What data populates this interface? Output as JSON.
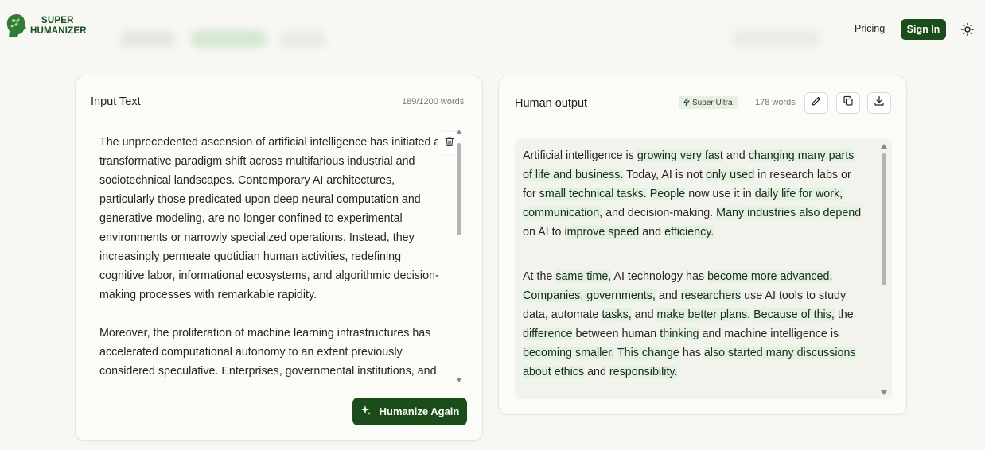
{
  "header": {
    "logo_line1": "SUPER",
    "logo_line2": "HUMANIZER",
    "pricing": "Pricing",
    "sign_in": "Sign In"
  },
  "input": {
    "title": "Input Text",
    "word_count": "189/1200 words",
    "paragraphs": [
      "The unprecedented ascension of artificial intelligence has initiated a transformative paradigm shift across multifarious industrial and sociotechnical landscapes. Contemporary AI architectures, particularly those predicated upon deep neural computation and generative modeling, are no longer confined to experimental environments or narrowly specialized operations. Instead, they increasingly permeate quotidian human activities, redefining cognitive labor, informational ecosystems, and algorithmic decision-making processes with remarkable rapidity.",
      "Moreover, the proliferation of machine learning infrastructures has accelerated computational autonomy to an extent previously considered speculative. Enterprises, governmental institutions, and"
    ],
    "humanize_button": "Humanize Again"
  },
  "output": {
    "title": "Human output",
    "badge": "Super Ultra",
    "word_count": "178 words",
    "paragraph1": [
      "Artificial intelligence is ",
      "growing very fast",
      " and ",
      "changing many parts",
      " ",
      "of life and business.",
      " Today, AI is not ",
      "only used",
      " in research labs or for ",
      "small technical tasks.",
      " ",
      "People",
      " now use it in ",
      "daily life for work,",
      " ",
      "communication,",
      " and decision-making. ",
      "Many industries also",
      " ",
      "depend",
      " on AI to ",
      "improve speed",
      " and ",
      "efficiency."
    ],
    "paragraph2": [
      "At the ",
      "same time,",
      " AI technology has ",
      "become more advanced.",
      " ",
      "Companies, governments,",
      " and ",
      "researchers",
      " use AI tools to study data, automate ",
      "tasks,",
      " and ",
      "make better plans.",
      " ",
      "Because of this,",
      " the ",
      "difference",
      " between human ",
      "thinking",
      " and machine intelligence is ",
      "becoming smaller.",
      " ",
      "This change",
      " has ",
      "also started many discussions",
      " ",
      "about ethics",
      " and ",
      "responsibility."
    ]
  },
  "colors": {
    "accent": "#1b4d1b",
    "highlight": "#e0f3df",
    "background": "#f7f7f3"
  },
  "icons": {
    "trash": "trash-icon",
    "sparkle": "sparkle-icon",
    "edit": "pencil-icon",
    "copy": "copy-icon",
    "download": "download-icon",
    "theme": "sun-icon"
  }
}
